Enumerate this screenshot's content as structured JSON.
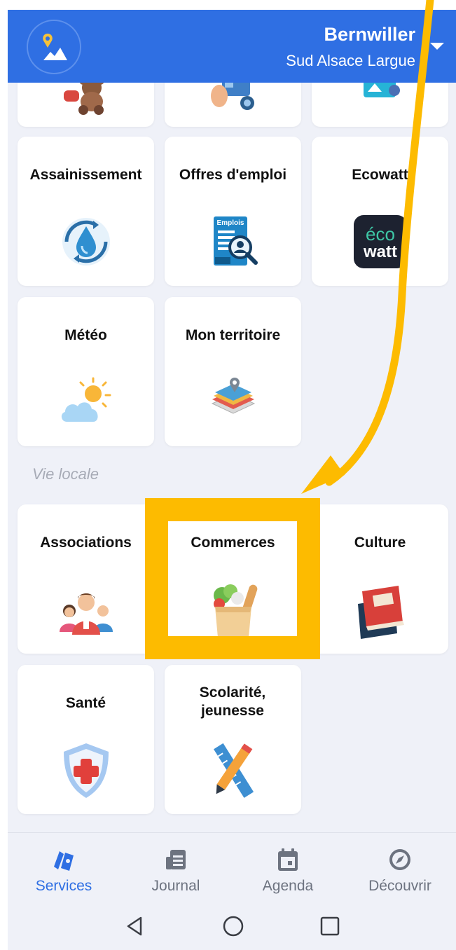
{
  "header": {
    "city": "Bernwiller",
    "region": "Sud Alsace Largue"
  },
  "tiles": [
    {
      "label": "Assainissement",
      "icon": "water-drop-cycle-icon"
    },
    {
      "label": "Offres d'emploi",
      "icon": "job-offers-icon"
    },
    {
      "label": "Ecowatt",
      "icon": "ecowatt-icon"
    },
    {
      "label": "Météo",
      "icon": "weather-sun-cloud-icon"
    },
    {
      "label": "Mon territoire",
      "icon": "map-layers-icon"
    }
  ],
  "section": {
    "label": "Vie locale"
  },
  "local_tiles": [
    {
      "label": "Associations",
      "icon": "people-group-icon"
    },
    {
      "label": "Commerces",
      "icon": "grocery-bag-icon"
    },
    {
      "label": "Culture",
      "icon": "books-icon"
    },
    {
      "label": "Santé",
      "icon": "health-shield-icon"
    },
    {
      "label": "Scolarité, jeunesse",
      "icon": "ruler-pencil-icon"
    }
  ],
  "ecowatt_badge": {
    "line1": "éco",
    "line2": "watt"
  },
  "emploi_badge": "Emplois",
  "bottom_nav": [
    {
      "label": "Services",
      "icon": "services-icon",
      "active": true
    },
    {
      "label": "Journal",
      "icon": "journal-icon",
      "active": false
    },
    {
      "label": "Agenda",
      "icon": "calendar-icon",
      "active": false
    },
    {
      "label": "Découvrir",
      "icon": "compass-icon",
      "active": false
    }
  ],
  "colors": {
    "primary": "#2f6fe3",
    "background": "#eff1f8",
    "annotation": "#fdbb00"
  }
}
